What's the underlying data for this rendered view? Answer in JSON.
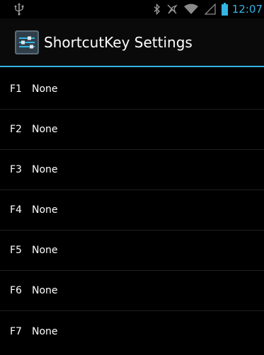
{
  "status_bar": {
    "icons": [
      "usb-icon",
      "bluetooth-icon",
      "mute-icon",
      "wifi-icon",
      "signal-icon",
      "battery-icon"
    ],
    "time": "12:07",
    "accent_color": "#33b5e5"
  },
  "action_bar": {
    "app_icon": "settings-sliders-icon",
    "title": "ShortcutKey Settings"
  },
  "shortcuts": [
    {
      "key": "F1",
      "value": "None"
    },
    {
      "key": "F2",
      "value": "None"
    },
    {
      "key": "F3",
      "value": "None"
    },
    {
      "key": "F4",
      "value": "None"
    },
    {
      "key": "F5",
      "value": "None"
    },
    {
      "key": "F6",
      "value": "None"
    },
    {
      "key": "F7",
      "value": "None"
    }
  ]
}
